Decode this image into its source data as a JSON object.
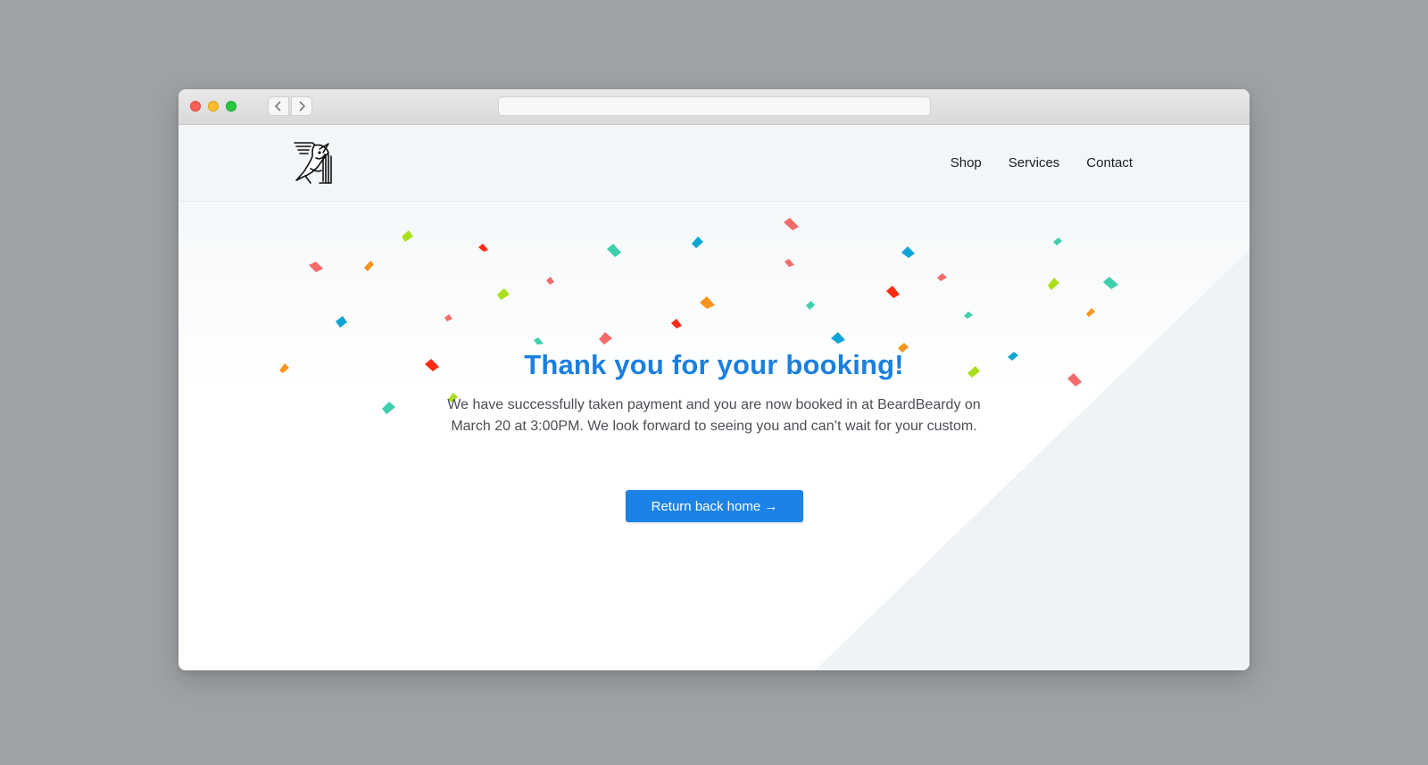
{
  "header": {
    "nav": [
      {
        "label": "Shop"
      },
      {
        "label": "Services"
      },
      {
        "label": "Contact"
      }
    ]
  },
  "main": {
    "title": "Thank you for your booking!",
    "message": "We have successfully taken payment and you are now booked in at BeardBeardy on March 20 at 3:00PM. We look forward to seeing you and can’t wait for your custom.",
    "button_label": "Return back home →"
  },
  "colors": {
    "accent": "#1a7fe0",
    "button": "#1b83e8",
    "confetti": [
      "#f36b6b",
      "#f7941d",
      "#a8e01b",
      "#ff2a12",
      "#3dcfae",
      "#0ea5d6"
    ]
  }
}
